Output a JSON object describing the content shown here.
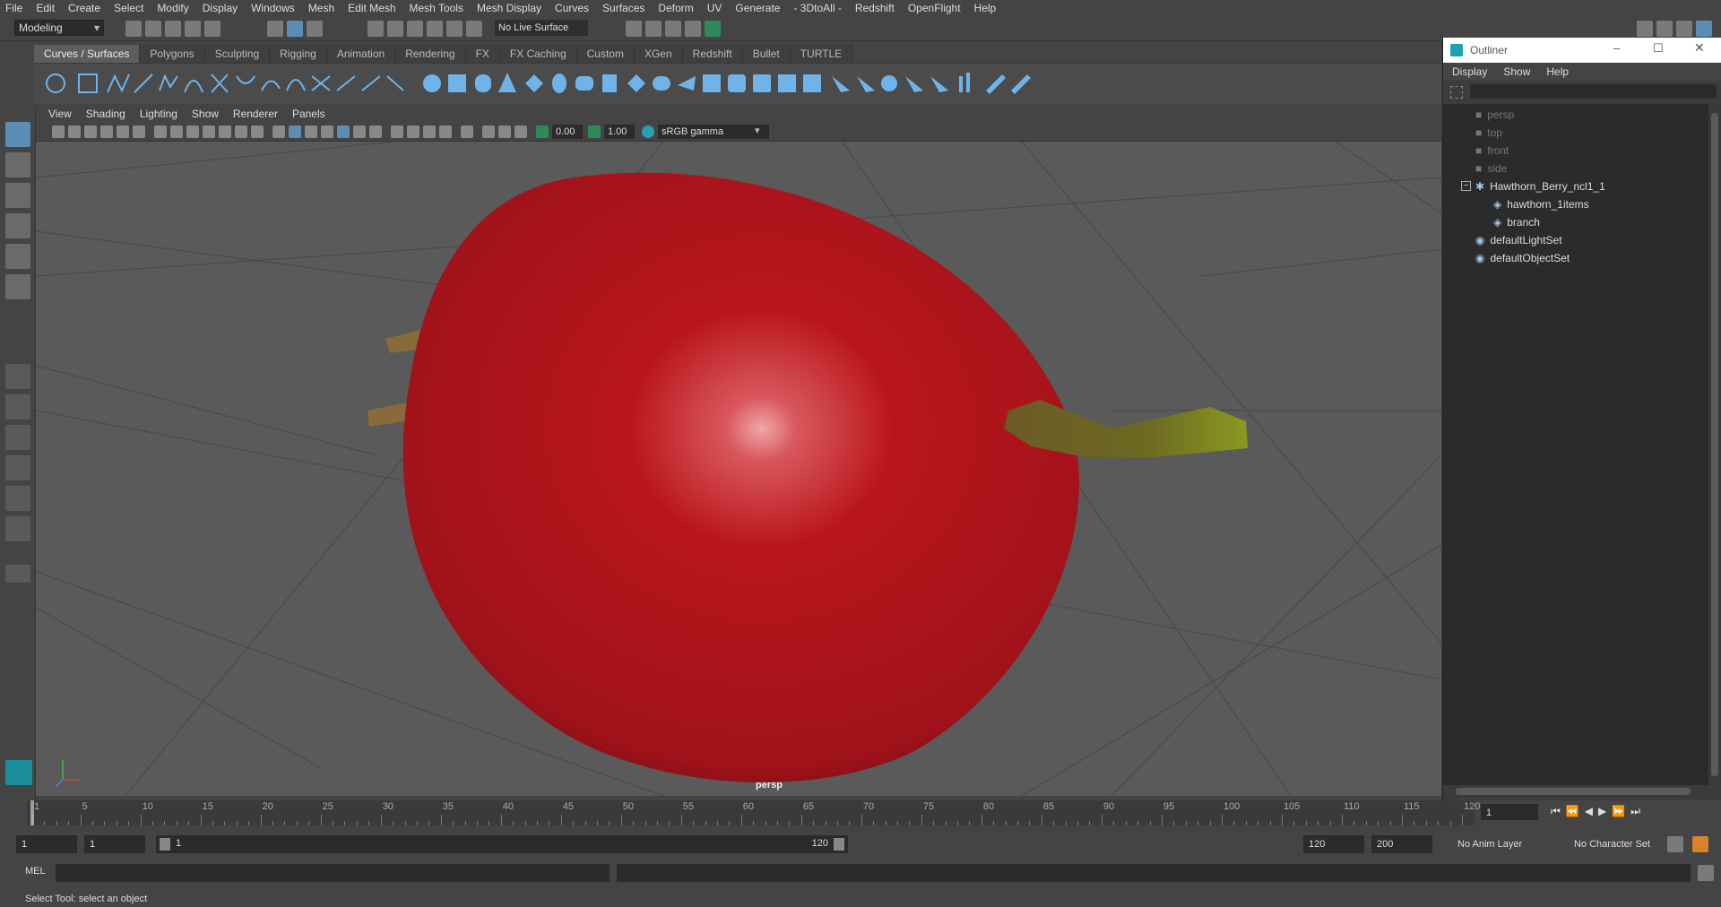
{
  "menubar": [
    "File",
    "Edit",
    "Create",
    "Select",
    "Modify",
    "Display",
    "Windows",
    "Mesh",
    "Edit Mesh",
    "Mesh Tools",
    "Mesh Display",
    "Curves",
    "Surfaces",
    "Deform",
    "UV",
    "Generate",
    "- 3DtoAll -",
    "Redshift",
    "OpenFlight",
    "Help"
  ],
  "statusline": {
    "mode": "Modeling",
    "live_surface": "No Live Surface"
  },
  "shelf_tabs": [
    "Curves / Surfaces",
    "Polygons",
    "Sculpting",
    "Rigging",
    "Animation",
    "Rendering",
    "FX",
    "FX Caching",
    "Custom",
    "XGen",
    "Redshift",
    "Bullet",
    "TURTLE"
  ],
  "viewport": {
    "menu": [
      "View",
      "Shading",
      "Lighting",
      "Show",
      "Renderer",
      "Panels"
    ],
    "exposure": "0.00",
    "gamma": "1.00",
    "colorspace": "sRGB gamma",
    "camera_label": "persp"
  },
  "outliner": {
    "title": "Outliner",
    "menu": [
      "Display",
      "Show",
      "Help"
    ],
    "items": [
      {
        "label": "persp",
        "indent": 0,
        "dim": true,
        "icon": "camera-icon"
      },
      {
        "label": "top",
        "indent": 0,
        "dim": true,
        "icon": "camera-icon"
      },
      {
        "label": "front",
        "indent": 0,
        "dim": true,
        "icon": "camera-icon"
      },
      {
        "label": "side",
        "indent": 0,
        "dim": true,
        "icon": "camera-icon"
      },
      {
        "label": "Hawthorn_Berry_ncl1_1",
        "indent": 0,
        "dim": false,
        "icon": "group-icon"
      },
      {
        "label": "hawthorn_1items",
        "indent": 1,
        "dim": false,
        "icon": "mesh-icon"
      },
      {
        "label": "branch",
        "indent": 1,
        "dim": false,
        "icon": "mesh-icon"
      },
      {
        "label": "defaultLightSet",
        "indent": 0,
        "dim": false,
        "icon": "set-icon"
      },
      {
        "label": "defaultObjectSet",
        "indent": 0,
        "dim": false,
        "icon": "set-icon"
      }
    ]
  },
  "timeline": {
    "ticks": [
      1,
      5,
      10,
      15,
      20,
      25,
      30,
      35,
      40,
      45,
      50,
      55,
      60,
      65,
      70,
      75,
      80,
      85,
      90,
      95,
      100,
      105,
      110,
      115,
      120
    ],
    "current_frame": "1"
  },
  "range": {
    "start": "1",
    "playback_start": "1",
    "slider_start": "1",
    "slider_end": "120",
    "playback_end": "120",
    "end": "200",
    "anim_layer": "No Anim Layer",
    "character_set": "No Character Set"
  },
  "cmdline": {
    "label": "MEL"
  },
  "helpline": "Select Tool: select an object",
  "colors": {
    "berry": "#b3151b",
    "stem": "#7a6a2a"
  }
}
